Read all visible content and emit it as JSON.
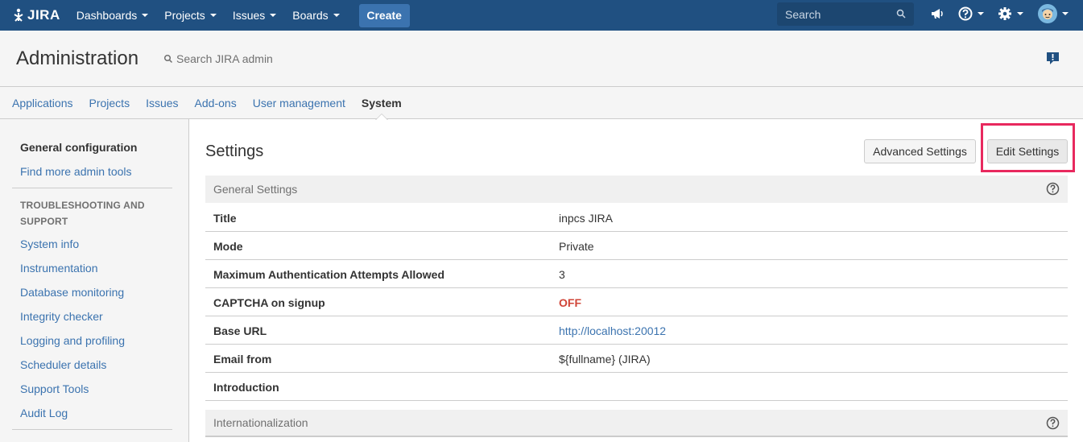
{
  "topbar": {
    "logo_text": "JIRA",
    "nav": [
      {
        "label": "Dashboards"
      },
      {
        "label": "Projects"
      },
      {
        "label": "Issues"
      },
      {
        "label": "Boards"
      }
    ],
    "create_label": "Create",
    "search_placeholder": "Search",
    "icons": [
      "megaphone-icon",
      "help-icon",
      "gear-icon",
      "avatar"
    ]
  },
  "admin": {
    "title": "Administration",
    "search_label": "Search JIRA admin"
  },
  "tabs": [
    {
      "label": "Applications"
    },
    {
      "label": "Projects"
    },
    {
      "label": "Issues"
    },
    {
      "label": "Add-ons"
    },
    {
      "label": "User management"
    },
    {
      "label": "System",
      "active": true
    }
  ],
  "sidebar": {
    "top_items": [
      {
        "label": "General configuration",
        "current": true
      },
      {
        "label": "Find more admin tools"
      }
    ],
    "heading": "TROUBLESHOOTING AND SUPPORT",
    "items": [
      {
        "label": "System info"
      },
      {
        "label": "Instrumentation"
      },
      {
        "label": "Database monitoring"
      },
      {
        "label": "Integrity checker"
      },
      {
        "label": "Logging and profiling"
      },
      {
        "label": "Scheduler details"
      },
      {
        "label": "Support Tools"
      },
      {
        "label": "Audit Log"
      }
    ]
  },
  "main": {
    "title": "Settings",
    "advanced_label": "Advanced Settings",
    "edit_label": "Edit Settings",
    "general_section": "General Settings",
    "rows": [
      {
        "key": "Title",
        "value": "inpcs JIRA"
      },
      {
        "key": "Mode",
        "value": "Private"
      },
      {
        "key": "Maximum Authentication Attempts Allowed",
        "value": "3"
      },
      {
        "key": "CAPTCHA on signup",
        "value": "OFF"
      },
      {
        "key": "Base URL",
        "value": "http://localhost:20012"
      },
      {
        "key": "Email from",
        "value": "${fullname} (JIRA)"
      },
      {
        "key": "Introduction",
        "value": ""
      }
    ],
    "i18n_section": "Internationalization"
  },
  "colors": {
    "topbar": "#205081",
    "link": "#3b73af",
    "off": "#d04437",
    "highlight": "#e8295e"
  }
}
